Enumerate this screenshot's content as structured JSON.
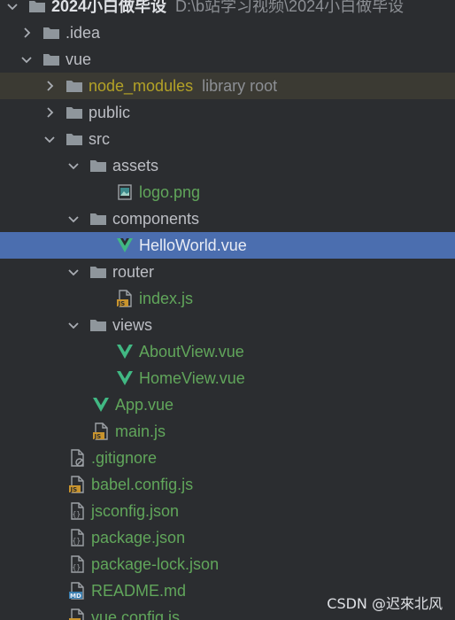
{
  "root": {
    "name": "2024小白做毕设",
    "path": "D:\\b站学习视频\\2024小白做毕设"
  },
  "nodes": {
    "idea": ".idea",
    "vue": "vue",
    "node_modules": "node_modules",
    "node_modules_hint": "library root",
    "public": "public",
    "src": "src",
    "assets": "assets",
    "logo": "logo.png",
    "components": "components",
    "helloworld": "HelloWorld.vue",
    "router": "router",
    "router_index": "index.js",
    "views": "views",
    "aboutview": "AboutView.vue",
    "homeview": "HomeView.vue",
    "app": "App.vue",
    "main": "main.js",
    "gitignore": ".gitignore",
    "babel": "babel.config.js",
    "jsconfig": "jsconfig.json",
    "package": "package.json",
    "packagelock": "package-lock.json",
    "readme": "README.md",
    "vueconfig": "vue.config.js"
  },
  "badges": {
    "js": "JS",
    "md": "MD"
  },
  "colors": {
    "background": "#2b2d30",
    "selection": "#4b6eaf",
    "library_row": "#3b3a33",
    "file_green": "#61a65b",
    "library_olive": "#b3a227"
  },
  "watermark": "CSDN @迟來北风"
}
